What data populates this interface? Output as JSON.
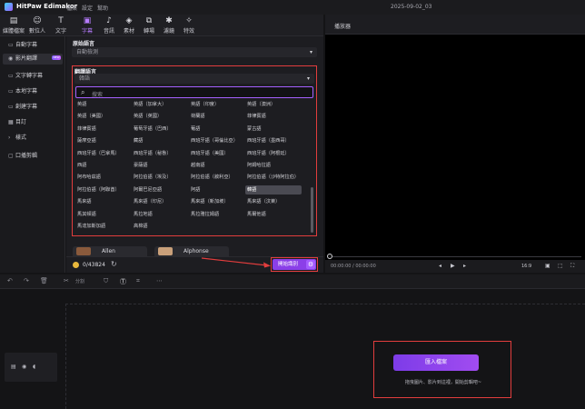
{
  "titlebar": {
    "app_name": "HitPaw Edimakor",
    "menus": [
      "檔案",
      "設定",
      "幫助"
    ],
    "date": "2025-09-02_03"
  },
  "toolbar": {
    "tools": [
      {
        "label": "媒體檔案",
        "icon": "media-icon"
      },
      {
        "label": "數位人",
        "icon": "avatar-icon"
      },
      {
        "label": "文字",
        "icon": "text-icon"
      },
      {
        "label": "字幕",
        "icon": "subtitle-icon",
        "active": true
      },
      {
        "label": "音訊",
        "icon": "audio-icon"
      },
      {
        "label": "素材",
        "icon": "asset-icon"
      },
      {
        "label": "轉場",
        "icon": "transition-icon"
      },
      {
        "label": "濾鏡",
        "icon": "filter-icon"
      },
      {
        "label": "特效",
        "icon": "effect-icon"
      }
    ]
  },
  "sidebar": {
    "items": [
      {
        "label": "自動字幕"
      },
      {
        "label": "影片翻譯",
        "active": true,
        "badge": "NEW"
      },
      {
        "label": "文字轉字幕"
      },
      {
        "label": "本地字幕"
      },
      {
        "label": "創建字幕"
      },
      {
        "label": "目訂"
      },
      {
        "label": "樣式"
      },
      {
        "label": "口播剪輯"
      }
    ]
  },
  "panel": {
    "source_label": "原始語言",
    "source_value": "自動檢測",
    "target_label": "翻譯語言",
    "target_value": "韓語",
    "search_placeholder": "搜索",
    "languages": [
      [
        "英語",
        "英語（加拿大）",
        "英語（印度）",
        "英語（澳洲）"
      ],
      [
        "英語（美國）",
        "英語（英國）",
        "荷蘭語",
        "菲律賓語"
      ],
      [
        "菲律賓語",
        "葡萄牙語（巴西）",
        "葡語",
        "蒙古語"
      ],
      [
        "薩摩亞語",
        "藏語",
        "西班牙語（哥倫比亞）",
        "西班牙語（墨西哥）"
      ],
      [
        "西班牙語（巴拿馬）",
        "西班牙語（秘魯）",
        "西班牙語（美國）",
        "西班牙語（阿根廷）"
      ],
      [
        "西語",
        "豪薩語",
        "越南語",
        "阿姆哈拉語"
      ],
      [
        "阿布哈茲語",
        "阿拉伯語（埃及）",
        "阿拉伯語（敘利亞）",
        "阿拉伯語（沙特阿拉伯）"
      ],
      [
        "阿拉伯語（阿聯酋）",
        "阿爾巴尼亞語",
        "阿語",
        "韓語"
      ],
      [
        "馬來語",
        "馬來語（印尼）",
        "馬來語（新加坡）",
        "馬來語（汶萊）"
      ],
      [
        "馬其頓語",
        "馬拉地語",
        "馬拉雅拉姆語",
        "馬爾他語"
      ],
      [
        "馬達加斯加語",
        "高棉語",
        "",
        ""
      ]
    ],
    "selected_language": "韓語",
    "voice_cards": [
      "Allen",
      "Alphonse"
    ],
    "points": "0/43824",
    "start_button": "開始識別"
  },
  "preview": {
    "title": "播放器",
    "timecode": "00:00:00 / 00:00:00",
    "aspect": "16:9"
  },
  "timeline": {
    "toolbar": [
      "↶",
      "↷",
      "🗑",
      "✂",
      "分割"
    ],
    "import_button": "匯入檔案",
    "import_hint": "拖曳圖片、影片到這裡，開始剪輯吧~"
  }
}
